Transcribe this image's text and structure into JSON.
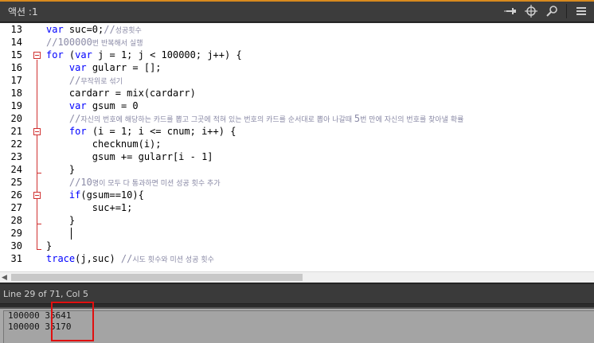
{
  "window": {
    "tab_title": "액션 :1",
    "accent_color": "#d88a1e",
    "tools": [
      "pin-icon",
      "target-icon",
      "search-icon",
      "menu-icon"
    ]
  },
  "editor": {
    "lines": [
      {
        "no": "13",
        "segments": [
          {
            "t": "var",
            "c": "kw"
          },
          {
            "t": " suc=0;"
          },
          {
            "t": "//",
            "c": "cm"
          },
          {
            "t": "성공횟수",
            "c": "cm-k"
          }
        ]
      },
      {
        "no": "14",
        "segments": [
          {
            "t": "//100000",
            "c": "cm"
          },
          {
            "t": "번 반복해서 실행",
            "c": "cm-k"
          }
        ]
      },
      {
        "no": "15",
        "segments": [
          {
            "t": "for",
            "c": "kw"
          },
          {
            "t": " ("
          },
          {
            "t": "var",
            "c": "kw"
          },
          {
            "t": " j = 1; j < 100000; j++) {"
          }
        ]
      },
      {
        "no": "16",
        "segments": [
          {
            "t": "    "
          },
          {
            "t": "var",
            "c": "kw"
          },
          {
            "t": " gularr = [];"
          }
        ]
      },
      {
        "no": "17",
        "segments": [
          {
            "t": "    "
          },
          {
            "t": "//",
            "c": "cm"
          },
          {
            "t": "무작위로 섞기",
            "c": "cm-k"
          }
        ]
      },
      {
        "no": "18",
        "segments": [
          {
            "t": "    cardarr = mix(cardarr)"
          }
        ]
      },
      {
        "no": "19",
        "segments": [
          {
            "t": "    "
          },
          {
            "t": "var",
            "c": "kw"
          },
          {
            "t": " gsum = 0"
          }
        ]
      },
      {
        "no": "20",
        "segments": [
          {
            "t": "    "
          },
          {
            "t": "//",
            "c": "cm"
          },
          {
            "t": "자신의 번호에 해당하는 카드를 뽑고 그곳에 적혀 있는 번호의 카드를 순서대로 뽑아 나갈때 ",
            "c": "cm-k"
          },
          {
            "t": "5",
            "c": "cm"
          },
          {
            "t": "번 만에 자신의 번호를 찾아낼 확률",
            "c": "cm-k"
          }
        ]
      },
      {
        "no": "21",
        "segments": [
          {
            "t": "    "
          },
          {
            "t": "for",
            "c": "kw"
          },
          {
            "t": " (i = 1; i <= cnum; i++) {"
          }
        ]
      },
      {
        "no": "22",
        "segments": [
          {
            "t": "        checknum(i);"
          }
        ]
      },
      {
        "no": "23",
        "segments": [
          {
            "t": "        gsum += gularr[i - 1]"
          }
        ]
      },
      {
        "no": "24",
        "segments": [
          {
            "t": "    }"
          }
        ]
      },
      {
        "no": "25",
        "segments": [
          {
            "t": "    "
          },
          {
            "t": "//10",
            "c": "cm"
          },
          {
            "t": "명이 모두 다 통과하면 미션 성공 횟수 추가",
            "c": "cm-k"
          }
        ]
      },
      {
        "no": "26",
        "segments": [
          {
            "t": "    "
          },
          {
            "t": "if",
            "c": "kw"
          },
          {
            "t": "(gsum==10){"
          }
        ]
      },
      {
        "no": "27",
        "segments": [
          {
            "t": "        suc+=1;"
          }
        ]
      },
      {
        "no": "28",
        "segments": [
          {
            "t": "    }"
          }
        ]
      },
      {
        "no": "29",
        "segments": [
          {
            "t": ""
          }
        ]
      },
      {
        "no": "30",
        "segments": [
          {
            "t": "}"
          }
        ]
      },
      {
        "no": "31",
        "segments": [
          {
            "t": "trace",
            "c": "kw"
          },
          {
            "t": "(j,suc) "
          },
          {
            "t": "//",
            "c": "cm"
          },
          {
            "t": "시도 횟수와 미션 성공 횟수",
            "c": "cm-k"
          }
        ]
      }
    ]
  },
  "status": {
    "text": "Line 29 of 71, Col 5"
  },
  "output": {
    "lines": [
      "100000 35641",
      "100000 35170"
    ]
  },
  "colors": {
    "keyword": "#0000ff",
    "comment": "#8a8aa6",
    "fold": "#d03030",
    "highlight": "#e01010"
  }
}
